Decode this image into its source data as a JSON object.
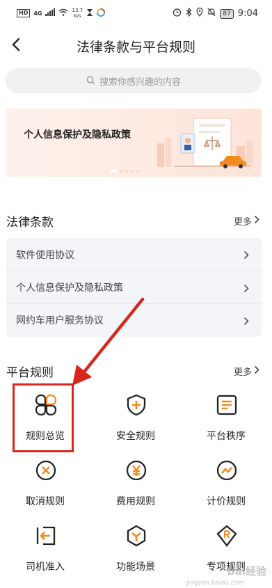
{
  "status_bar": {
    "hd": "HD",
    "net": "4G",
    "speed_value": "13.7",
    "speed_unit": "K/s",
    "battery": "87",
    "time": "9:04"
  },
  "header": {
    "title": "法律条款与平台规则"
  },
  "search": {
    "placeholder": "搜索你感兴趣的内容"
  },
  "banner": {
    "text": "个人信息保护及隐私政策"
  },
  "legal": {
    "title": "法律条款",
    "more": "更多",
    "items": [
      {
        "label": "软件使用协议"
      },
      {
        "label": "个人信息保护及隐私政策"
      },
      {
        "label": "网约车用户服务协议"
      }
    ]
  },
  "platform": {
    "title": "平台规则",
    "more": "更多",
    "rules": [
      {
        "label": "规则总览",
        "icon": "overview-icon"
      },
      {
        "label": "安全规则",
        "icon": "shield-plus-icon"
      },
      {
        "label": "平台秩序",
        "icon": "document-icon"
      },
      {
        "label": "取消规则",
        "icon": "cancel-icon"
      },
      {
        "label": "费用规则",
        "icon": "yen-icon"
      },
      {
        "label": "计价规则",
        "icon": "trend-icon"
      },
      {
        "label": "司机准入",
        "icon": "entry-icon"
      },
      {
        "label": "功能场景",
        "icon": "hexagon-icon"
      },
      {
        "label": "专项规则",
        "icon": "badge-r-icon"
      }
    ]
  },
  "watermark": {
    "text": "Bai经验",
    "sub": "jingyan.baidu.com"
  },
  "colors": {
    "accent": "#f28b1e",
    "highlight": "#d9261c"
  }
}
